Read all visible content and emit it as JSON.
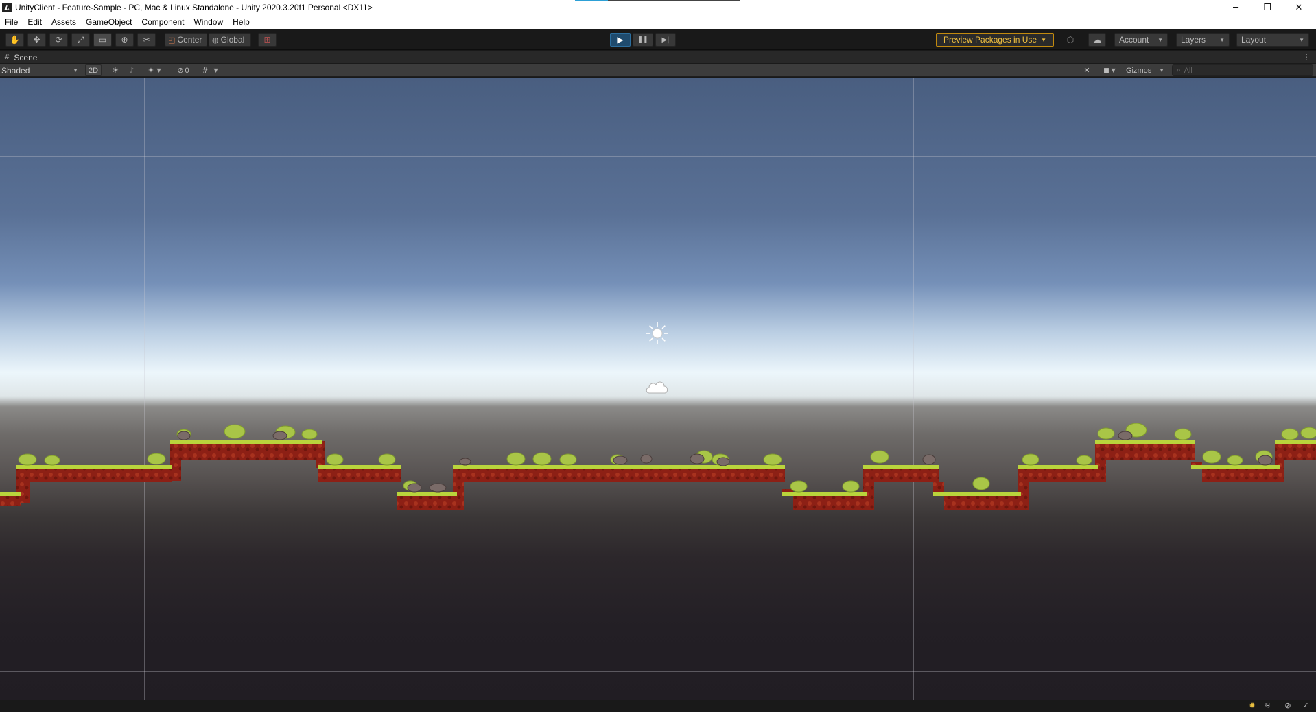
{
  "window": {
    "title": "UnityClient - Feature-Sample - PC, Mac & Linux Standalone - Unity 2020.3.20f1 Personal <DX11>",
    "app_icon": "unity-logo-icon",
    "controls": {
      "minimize": "─",
      "maximize": "❐",
      "close": "✕"
    }
  },
  "menu": [
    "File",
    "Edit",
    "Assets",
    "GameObject",
    "Component",
    "Window",
    "Help"
  ],
  "toolbar": {
    "tools": [
      {
        "name": "hand-tool-icon",
        "glyph": "✋"
      },
      {
        "name": "move-tool-icon",
        "glyph": "✥"
      },
      {
        "name": "rotate-tool-icon",
        "glyph": "⟳"
      },
      {
        "name": "scale-tool-icon",
        "glyph": "⤢"
      },
      {
        "name": "rect-tool-icon",
        "glyph": "▭"
      },
      {
        "name": "transform-tool-icon",
        "glyph": "⊕"
      },
      {
        "name": "custom-tool-icon",
        "glyph": "✂"
      }
    ],
    "pivot_label": "Center",
    "space_label": "Global",
    "snap_glyph": "⊞",
    "play_glyph": "▶",
    "pause_glyph": "❚❚",
    "step_glyph": "▶|",
    "preview_packages_label": "Preview Packages in Use",
    "collab_glyph": "⬡",
    "cloud_glyph": "☁",
    "account_label": "Account",
    "layers_label": "Layers",
    "layout_label": "Layout",
    "caret": "▼"
  },
  "scene_tab": {
    "label": "Scene",
    "icon_glyph": "#",
    "menu_glyph": "⋮"
  },
  "scene_toolbar": {
    "shading_mode": "Shaded",
    "mode_2d_label": "2D",
    "lighting_glyph": "☀",
    "audio_glyph": "♪",
    "effects_glyph": "✦",
    "hidden_glyph": "⊘",
    "hidden_count": "0",
    "grid_glyph": "#",
    "tools_glyph": "✕",
    "camera_glyph": "■",
    "gizmos_label": "Gizmos",
    "search_placeholder": "All",
    "search_glyph": "⌕"
  },
  "colors": {
    "accent": "#2da0d6",
    "play_active": "#1f4b6e",
    "preview_warning": "#f0c040",
    "grass": "#b9d43c",
    "dirt": "#8b1f14"
  },
  "status_icons": [
    "lightbulb-icon",
    "layers-icon",
    "auto-generate-lighting-icon",
    "check-icon"
  ]
}
